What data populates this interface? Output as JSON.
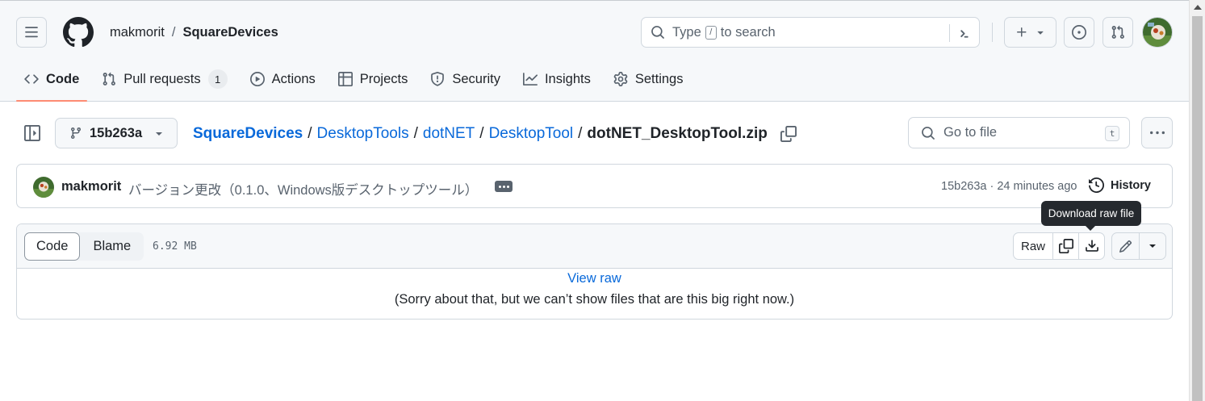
{
  "header": {
    "owner": "makmorit",
    "separator": "/",
    "repo": "SquareDevices",
    "search_placeholder_pre": "Type",
    "search_key": "/",
    "search_placeholder_post": "to search"
  },
  "tabs": [
    {
      "label": "Code",
      "icon": "code-icon",
      "active": true
    },
    {
      "label": "Pull requests",
      "icon": "pull-request-icon",
      "count": "1"
    },
    {
      "label": "Actions",
      "icon": "play-icon"
    },
    {
      "label": "Projects",
      "icon": "table-icon"
    },
    {
      "label": "Security",
      "icon": "shield-icon"
    },
    {
      "label": "Insights",
      "icon": "graph-icon"
    },
    {
      "label": "Settings",
      "icon": "gear-icon"
    }
  ],
  "file_nav": {
    "branch": "15b263a",
    "breadcrumb": [
      "SquareDevices",
      "DesktopTools",
      "dotNET",
      "DesktopTool"
    ],
    "current_file": "dotNET_DesktopTool.zip",
    "goto_placeholder": "Go to file",
    "goto_key": "t"
  },
  "commit": {
    "author": "makmorit",
    "message": "バージョン更改（0.1.0、Windows版デスクトップツール）",
    "meta": "15b263a · 24 minutes ago",
    "history_label": "History"
  },
  "file": {
    "code_tab": "Code",
    "blame_tab": "Blame",
    "size": "6.92 MB",
    "raw_label": "Raw",
    "view_raw": "View raw",
    "notice": "(Sorry about that, but we can’t show files that are this big right now.)",
    "tooltip": "Download raw file"
  },
  "colors": {
    "accent_link": "#0969da",
    "tab_underline": "#fd8c73",
    "border": "#d0d7de",
    "muted_text": "#59636e"
  }
}
